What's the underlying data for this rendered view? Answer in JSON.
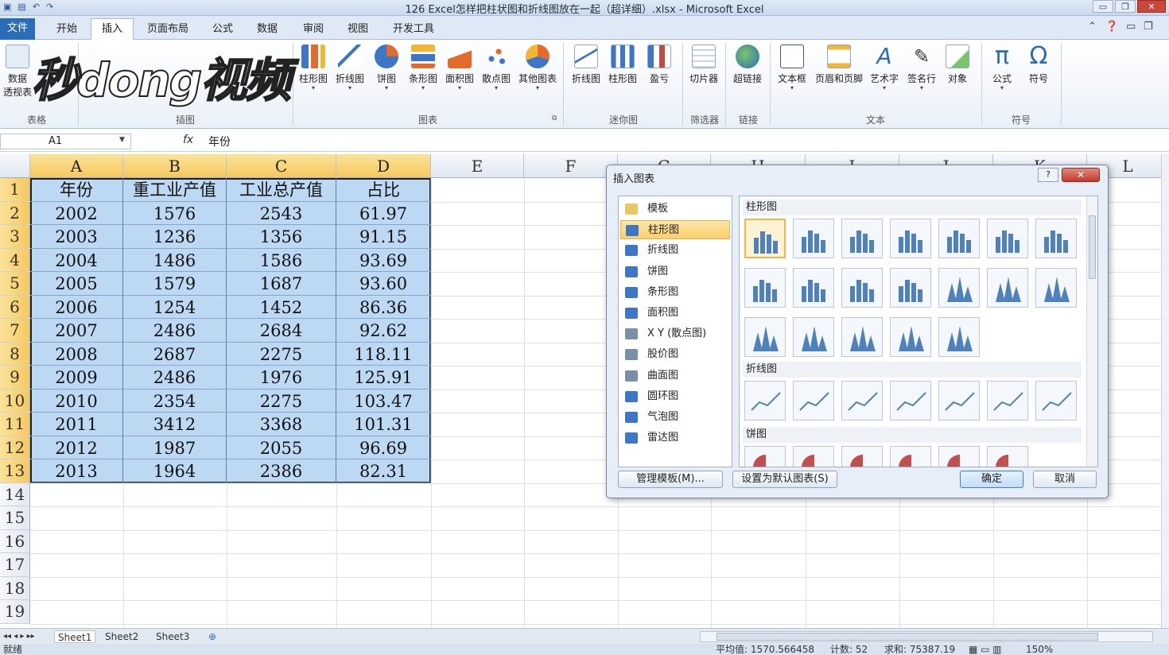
{
  "window": {
    "title": "126 Excel怎样把柱状图和折线图放在一起（超详细）.xlsx - Microsoft Excel",
    "min": "▭",
    "restore": "❐",
    "close": "✕"
  },
  "ribbon_tabs": [
    "文件",
    "开始",
    "插入",
    "页面布局",
    "公式",
    "数据",
    "审阅",
    "视图",
    "开发工具"
  ],
  "ribbon_active_tab": "插入",
  "ribbon": {
    "table_group": {
      "btn1": "数据",
      "btn1b": "透视表",
      "label": "表格"
    },
    "illustrations_label": "插图",
    "charts": [
      "柱形图",
      "折线图",
      "饼图",
      "条形图",
      "面积图",
      "散点图",
      "其他图表"
    ],
    "charts_label": "图表",
    "sparklines": [
      "折线图",
      "柱形图",
      "盈亏"
    ],
    "sparklines_label": "迷你图",
    "slicer": "切片器",
    "filter_label": "筛选器",
    "hyperlink": "超链接",
    "links_label": "链接",
    "text_btns": [
      "文本框",
      "页眉和页脚",
      "艺术字",
      "签名行",
      "对象"
    ],
    "text_label": "文本",
    "symbols": [
      "公式",
      "符号"
    ],
    "symbols_label": "符号"
  },
  "watermark": "秒dong视频",
  "formula_bar": {
    "name_box": "A1",
    "fx": "fx",
    "content": "年份"
  },
  "columns": [
    "A",
    "B",
    "C",
    "D",
    "E",
    "F",
    "G",
    "H",
    "I",
    "J",
    "K",
    "L"
  ],
  "rows": [
    "1",
    "2",
    "3",
    "4",
    "5",
    "6",
    "7",
    "8",
    "9",
    "10",
    "11",
    "12",
    "13",
    "14",
    "15",
    "16",
    "17",
    "18",
    "19"
  ],
  "table": {
    "headers": [
      "年份",
      "重工业产值",
      "工业总产值",
      "占比"
    ],
    "rows": [
      [
        "2002",
        "1576",
        "2543",
        "61.97"
      ],
      [
        "2003",
        "1236",
        "1356",
        "91.15"
      ],
      [
        "2004",
        "1486",
        "1586",
        "93.69"
      ],
      [
        "2005",
        "1579",
        "1687",
        "93.60"
      ],
      [
        "2006",
        "1254",
        "1452",
        "86.36"
      ],
      [
        "2007",
        "2486",
        "2684",
        "92.62"
      ],
      [
        "2008",
        "2687",
        "2275",
        "118.11"
      ],
      [
        "2009",
        "2486",
        "1976",
        "125.91"
      ],
      [
        "2010",
        "2354",
        "2275",
        "103.47"
      ],
      [
        "2011",
        "3412",
        "3368",
        "101.31"
      ],
      [
        "2012",
        "1987",
        "2055",
        "96.69"
      ],
      [
        "2013",
        "1964",
        "2386",
        "82.31"
      ]
    ]
  },
  "dialog": {
    "title": "插入图表",
    "help": "?",
    "close": "✕",
    "categories": [
      "模板",
      "柱形图",
      "折线图",
      "饼图",
      "条形图",
      "面积图",
      "X Y (散点图)",
      "股价图",
      "曲面图",
      "圆环图",
      "气泡图",
      "雷达图"
    ],
    "selected_category": "柱形图",
    "sections": [
      "柱形图",
      "折线图",
      "饼图"
    ],
    "manage_templates": "管理模板(M)...",
    "set_default": "设置为默认图表(S)",
    "ok": "确定",
    "cancel": "取消"
  },
  "sheets": [
    "Sheet1",
    "Sheet2",
    "Sheet3"
  ],
  "status": {
    "ready": "就绪",
    "average": "平均值: 1570.566458",
    "count": "计数: 52",
    "sum": "求和: 75387.19",
    "zoom": "150%"
  },
  "colors": {
    "accent": "#2b6cb8",
    "selection": "#bcd8f3",
    "header_sel": "#f6c85e"
  }
}
